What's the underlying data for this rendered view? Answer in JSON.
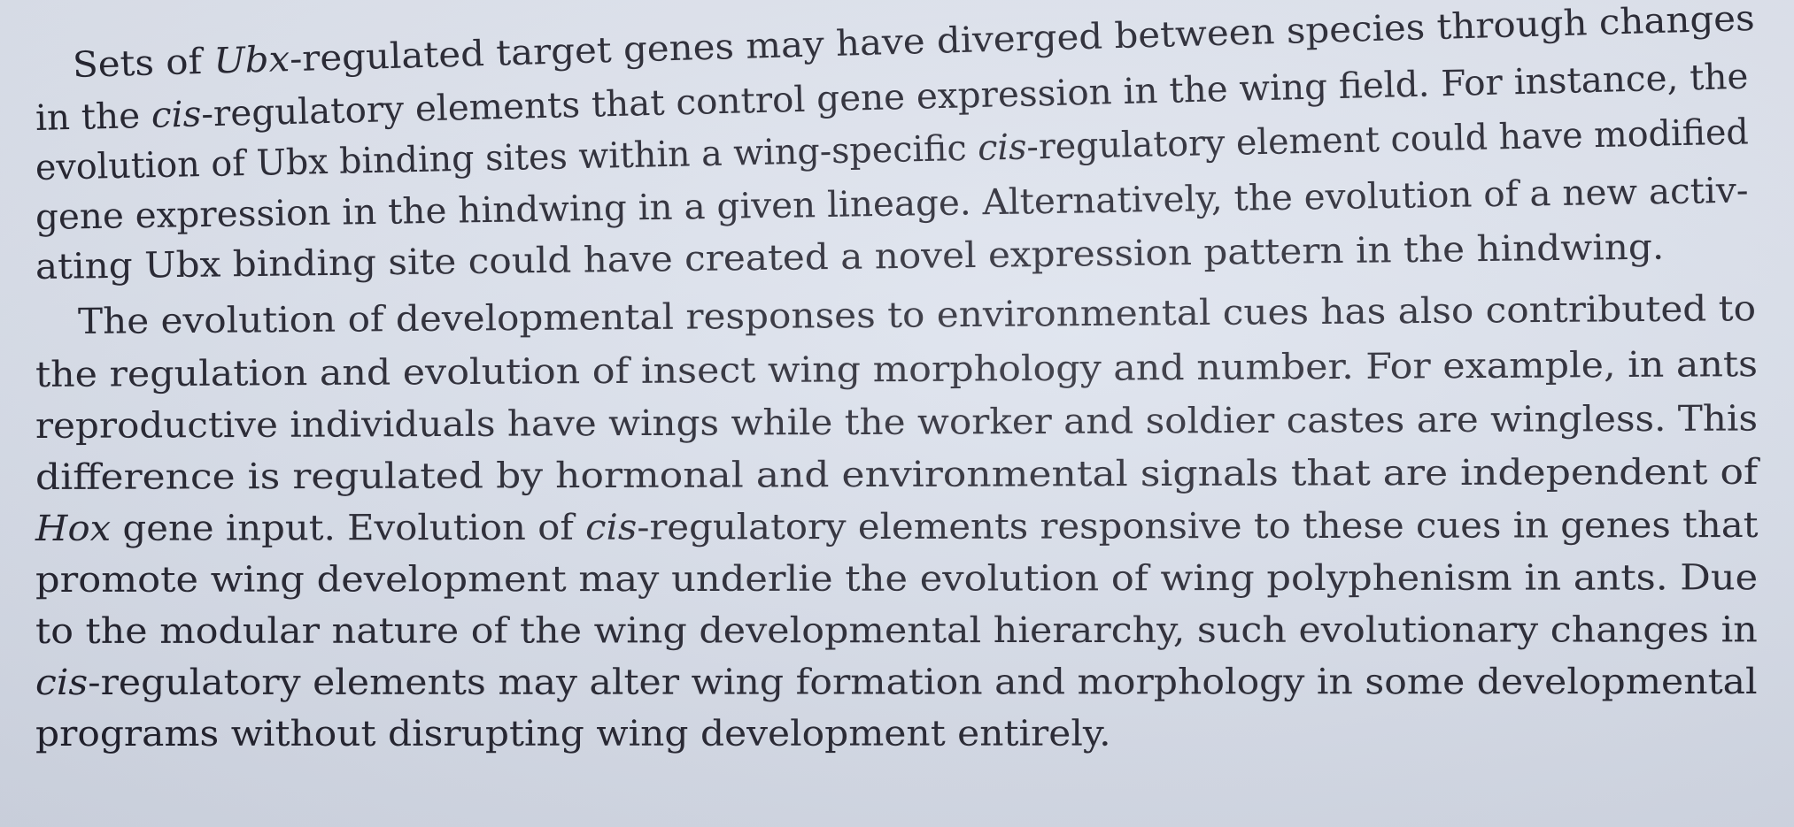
{
  "paragraphs": [
    {
      "lines": [
        [
          "Sets of ",
          {
            "i": "Ubx"
          },
          "-regulated target genes may have diverged between species through changes"
        ],
        [
          "in the ",
          {
            "i": "cis"
          },
          "-regulatory elements that control gene expression in the wing field. For instance, the"
        ],
        [
          "evolution of Ubx binding sites within a wing-specific ",
          {
            "i": "cis"
          },
          "-regulatory element could have modified"
        ],
        [
          "gene expression in the hindwing in a given lineage. Alternatively, the evolution of a new activ-"
        ],
        [
          "ating Ubx binding site could have created a novel expression pattern in the hindwing."
        ]
      ]
    },
    {
      "lines": [
        [
          "The evolution of developmental responses to environmental cues has also contributed to"
        ],
        [
          "the regulation and evolution of insect wing morphology and number. For example, in ants"
        ],
        [
          "reproductive individuals have wings while the worker and soldier castes are wingless. This"
        ],
        [
          "difference is regulated by hormonal and environmental signals that are independent of"
        ],
        [
          {
            "i": "Hox"
          },
          " gene input. Evolution of ",
          {
            "i": "cis"
          },
          "-regulatory elements responsive to these cues in genes that"
        ],
        [
          "promote wing development may underlie the evolution of wing polyphenism in ants. Due"
        ],
        [
          "to the modular nature of the wing developmental hierarchy, such evolutionary changes in"
        ],
        [
          {
            "i": "cis"
          },
          "-regulatory elements may alter wing formation and morphology in some developmental"
        ],
        [
          "programs without disrupting wing development entirely."
        ]
      ]
    }
  ]
}
